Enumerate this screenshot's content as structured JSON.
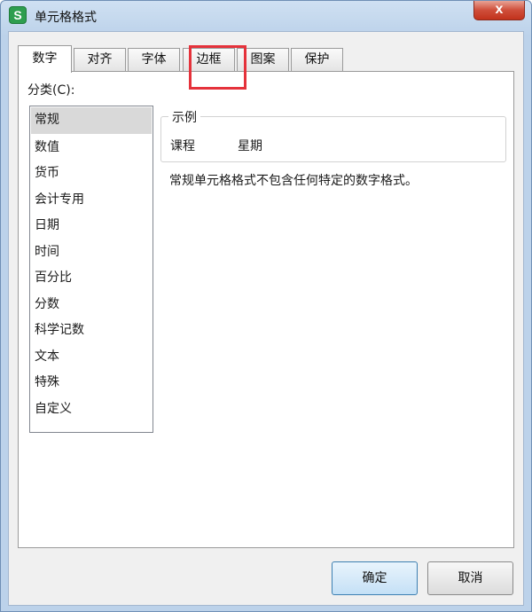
{
  "window": {
    "app_icon_letter": "S",
    "title": "单元格格式",
    "close_label": "x"
  },
  "tabs": [
    {
      "label": "数字",
      "active": true
    },
    {
      "label": "对齐",
      "active": false
    },
    {
      "label": "字体",
      "active": false
    },
    {
      "label": "边框",
      "active": false,
      "highlighted": true
    },
    {
      "label": "图案",
      "active": false
    },
    {
      "label": "保护",
      "active": false
    }
  ],
  "category": {
    "label": "分类(C):",
    "items": [
      "常规",
      "数值",
      "货币",
      "会计专用",
      "日期",
      "时间",
      "百分比",
      "分数",
      "科学记数",
      "文本",
      "特殊",
      "自定义"
    ],
    "selected": "常规"
  },
  "sample": {
    "legend": "示例",
    "value_a": "课程",
    "value_b": "星期"
  },
  "description": "常规单元格格式不包含任何特定的数字格式。",
  "buttons": {
    "ok_label": "确定",
    "cancel_label": "取消"
  },
  "colors": {
    "highlight_border": "#e5323b",
    "app_icon": "#2e9e4f",
    "close_button": "#c2321c"
  }
}
